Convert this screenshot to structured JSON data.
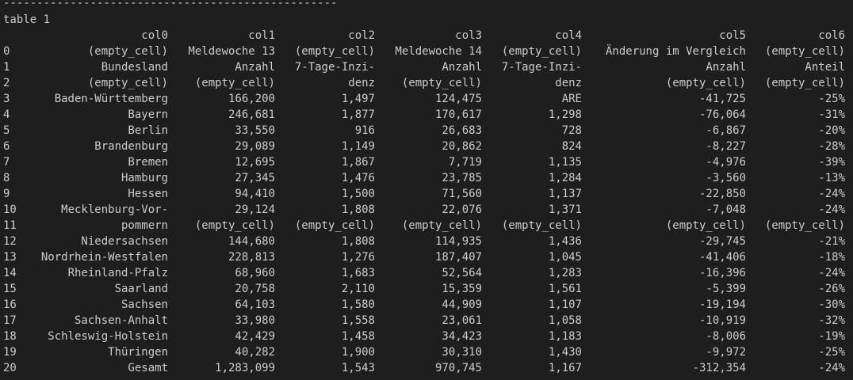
{
  "terminal": {
    "separator": "--------------------------------------------------",
    "caption": "table 1",
    "header": [
      "col0",
      "col1",
      "col2",
      "col3",
      "col4",
      "col5",
      "col6"
    ],
    "rows": [
      {
        "index": "0",
        "cells": [
          "(empty_cell)",
          "Meldewoche 13",
          "(empty_cell)",
          "Meldewoche 14",
          "(empty_cell)",
          "Änderung im Vergleich",
          "(empty_cell)"
        ]
      },
      {
        "index": "1",
        "cells": [
          "Bundesland",
          "Anzahl",
          "7-Tage-Inzi-",
          "Anzahl",
          "7-Tage-Inzi-",
          "Anzahl",
          "Anteil"
        ]
      },
      {
        "index": "2",
        "cells": [
          "(empty_cell)",
          "(empty_cell)",
          "denz",
          "(empty_cell)",
          "denz",
          "(empty_cell)",
          "(empty_cell)"
        ]
      },
      {
        "index": "3",
        "cells": [
          "Baden-Württemberg",
          "166,200",
          "1,497",
          "124,475",
          "ARE",
          "-41,725",
          "-25%"
        ]
      },
      {
        "index": "4",
        "cells": [
          "Bayern",
          "246,681",
          "1,877",
          "170,617",
          "1,298",
          "-76,064",
          "-31%"
        ]
      },
      {
        "index": "5",
        "cells": [
          "Berlin",
          "33,550",
          "916",
          "26,683",
          "728",
          "-6,867",
          "-20%"
        ]
      },
      {
        "index": "6",
        "cells": [
          "Brandenburg",
          "29,089",
          "1,149",
          "20,862",
          "824",
          "-8,227",
          "-28%"
        ]
      },
      {
        "index": "7",
        "cells": [
          "Bremen",
          "12,695",
          "1,867",
          "7,719",
          "1,135",
          "-4,976",
          "-39%"
        ]
      },
      {
        "index": "8",
        "cells": [
          "Hamburg",
          "27,345",
          "1,476",
          "23,785",
          "1,284",
          "-3,560",
          "-13%"
        ]
      },
      {
        "index": "9",
        "cells": [
          "Hessen",
          "94,410",
          "1,500",
          "71,560",
          "1,137",
          "-22,850",
          "-24%"
        ]
      },
      {
        "index": "10",
        "cells": [
          "Mecklenburg-Vor-",
          "29,124",
          "1,808",
          "22,076",
          "1,371",
          "-7,048",
          "-24%"
        ]
      },
      {
        "index": "11",
        "cells": [
          "pommern",
          "(empty_cell)",
          "(empty_cell)",
          "(empty_cell)",
          "(empty_cell)",
          "(empty_cell)",
          "(empty_cell)"
        ]
      },
      {
        "index": "12",
        "cells": [
          "Niedersachsen",
          "144,680",
          "1,808",
          "114,935",
          "1,436",
          "-29,745",
          "-21%"
        ]
      },
      {
        "index": "13",
        "cells": [
          "Nordrhein-Westfalen",
          "228,813",
          "1,276",
          "187,407",
          "1,045",
          "-41,406",
          "-18%"
        ]
      },
      {
        "index": "14",
        "cells": [
          "Rheinland-Pfalz",
          "68,960",
          "1,683",
          "52,564",
          "1,283",
          "-16,396",
          "-24%"
        ]
      },
      {
        "index": "15",
        "cells": [
          "Saarland",
          "20,758",
          "2,110",
          "15,359",
          "1,561",
          "-5,399",
          "-26%"
        ]
      },
      {
        "index": "16",
        "cells": [
          "Sachsen",
          "64,103",
          "1,580",
          "44,909",
          "1,107",
          "-19,194",
          "-30%"
        ]
      },
      {
        "index": "17",
        "cells": [
          "Sachsen-Anhalt",
          "33,980",
          "1,558",
          "23,061",
          "1,058",
          "-10,919",
          "-32%"
        ]
      },
      {
        "index": "18",
        "cells": [
          "Schleswig-Holstein",
          "42,429",
          "1,458",
          "34,423",
          "1,183",
          "-8,006",
          "-19%"
        ]
      },
      {
        "index": "19",
        "cells": [
          "Thüringen",
          "40,282",
          "1,900",
          "30,310",
          "1,430",
          "-9,972",
          "-25%"
        ]
      },
      {
        "index": "20",
        "cells": [
          "Gesamt",
          "1,283,099",
          "1,543",
          "970,745",
          "1,167",
          "-312,354",
          "-24%"
        ]
      }
    ]
  }
}
